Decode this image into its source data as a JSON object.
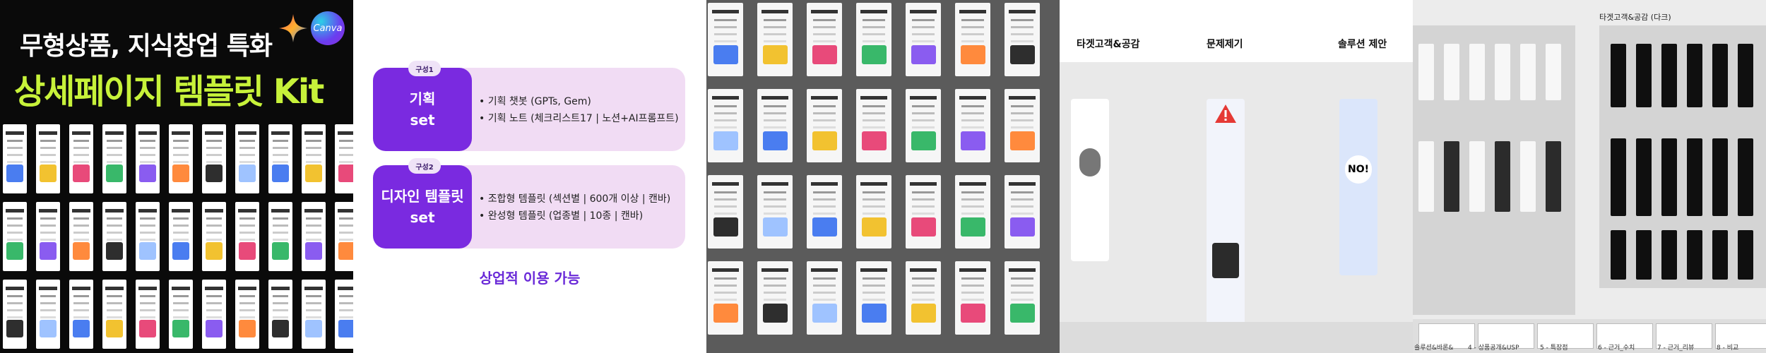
{
  "cover": {
    "headline_top": "무형상품, 지식창업 특화",
    "headline_main": "상세페이지 템플릿 Kit",
    "canva_logo": "Canva",
    "colors": {
      "accent": "#c7f23a",
      "background": "#0a0a0a"
    },
    "sparkle_icon": "gemini-sparkle-icon"
  },
  "features": {
    "sets": [
      {
        "badge": "구성1",
        "title_line1": "기획",
        "title_line2": "set",
        "bullets": [
          "기획 챗봇 (GPTs, Gem)",
          "기획 노트 (체크리스트17 | 노션+AI프롬프트)"
        ]
      },
      {
        "badge": "구성2",
        "title_line1": "디자인 템플릿",
        "title_line2": "set",
        "bullets": [
          "조합형 템플릿 (섹션별 | 600개 이상 | 캔바)",
          "완성형 템플릿 (업종별 | 10종 | 캔바)"
        ]
      }
    ],
    "footer": "상업적 이용 가능",
    "colors": {
      "tile": "#7a2ae0",
      "card": "#f1dcf4",
      "footer_text": "#6a2ad8"
    }
  },
  "board": {
    "sections": [
      "타겟고객&공감",
      "문제제기",
      "솔루션 제안"
    ],
    "solution_card_text": "NO!"
  },
  "frames": {
    "title": "타겟고객&공감 (다크)",
    "pages": [
      "솔루션&바론&",
      "4 - 상품공개&USP",
      "5 - 특장점",
      "6 - 근거_수치",
      "7 - 근거_리뷰",
      "8 - 비교"
    ]
  }
}
